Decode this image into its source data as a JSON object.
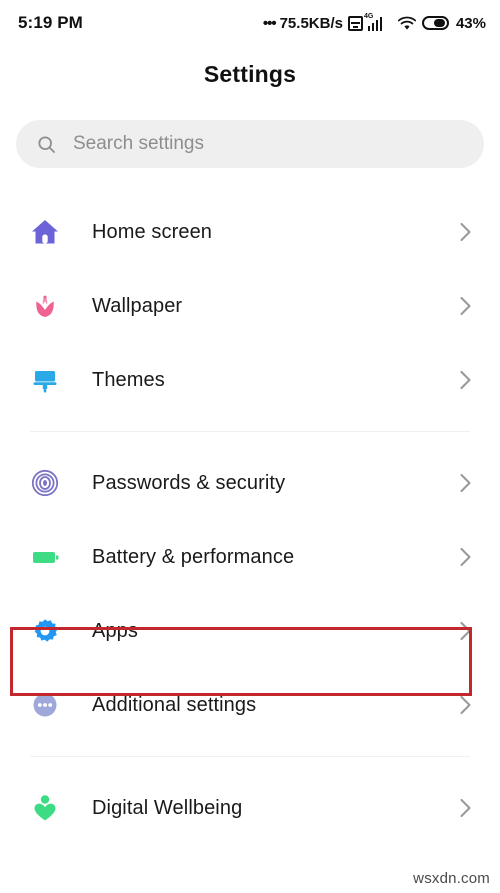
{
  "status_bar": {
    "clock": "5:19 PM",
    "dots": "•••",
    "network_speed": "75.5KB/s",
    "data_icon": "data-square-icon",
    "network_type": "4G",
    "signal_icon": "signal-bars-icon",
    "wifi_icon": "wifi-icon",
    "battery_icon": "battery-icon",
    "battery_percent": "43%"
  },
  "header": {
    "title": "Settings"
  },
  "search": {
    "icon": "search-icon",
    "placeholder": "Search settings",
    "value": ""
  },
  "groups": [
    {
      "id": "personalization",
      "items": [
        {
          "label": "Home screen",
          "icon": "home-icon",
          "color": "#6C63D9",
          "chevron": "chevron-right-icon"
        },
        {
          "label": "Wallpaper",
          "icon": "tulip-icon",
          "color": "#F06292",
          "chevron": "chevron-right-icon"
        },
        {
          "label": "Themes",
          "icon": "paint-roller-icon",
          "color": "#29A9E8",
          "chevron": "chevron-right-icon"
        }
      ]
    },
    {
      "id": "system",
      "items": [
        {
          "label": "Passwords & security",
          "icon": "fingerprint-icon",
          "color": "#7B74C4",
          "chevron": "chevron-right-icon"
        },
        {
          "label": "Battery & performance",
          "icon": "battery-green-icon",
          "color": "#3DDC84",
          "chevron": "chevron-right-icon"
        },
        {
          "label": "Apps",
          "icon": "gear-icon",
          "color": "#2196F3",
          "chevron": "chevron-right-icon",
          "highlighted": true
        },
        {
          "label": "Additional settings",
          "icon": "three-dots-circle-icon",
          "color": "#9FA8DA",
          "chevron": "chevron-right-icon"
        }
      ]
    },
    {
      "id": "wellbeing",
      "items": [
        {
          "label": "Digital Wellbeing",
          "icon": "person-heart-icon",
          "color": "#3DDC84",
          "chevron": "chevron-right-icon"
        }
      ]
    }
  ],
  "annotation": {
    "highlight_color": "#C1272D",
    "target": "Apps"
  },
  "watermark": {
    "text": "wsxdn.com"
  }
}
